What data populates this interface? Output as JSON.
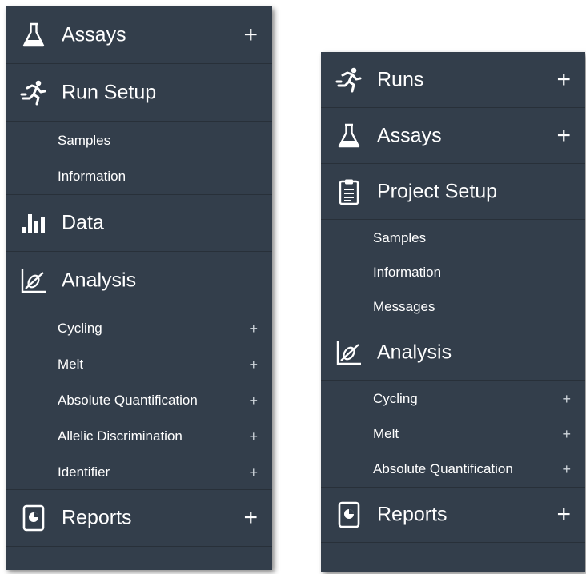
{
  "left_menu": {
    "assays": {
      "label": "Assays",
      "icon": "flask-icon",
      "expand": "+"
    },
    "run_setup": {
      "label": "Run Setup",
      "icon": "runner-icon"
    },
    "run_setup_items": [
      {
        "label": "Samples"
      },
      {
        "label": "Information"
      }
    ],
    "data": {
      "label": "Data",
      "icon": "bar-chart-icon"
    },
    "analysis": {
      "label": "Analysis",
      "icon": "analysis-chart-icon"
    },
    "analysis_items": [
      {
        "label": "Cycling",
        "expand": "+"
      },
      {
        "label": "Melt",
        "expand": "+"
      },
      {
        "label": "Absolute Quantification",
        "expand": "+"
      },
      {
        "label": "Allelic Discrimination",
        "expand": "+"
      },
      {
        "label": "Identifier",
        "expand": "+"
      }
    ],
    "reports": {
      "label": "Reports",
      "icon": "report-icon",
      "expand": "+"
    }
  },
  "right_menu": {
    "runs": {
      "label": "Runs",
      "icon": "runner-icon",
      "expand": "+"
    },
    "assays": {
      "label": "Assays",
      "icon": "flask-icon",
      "expand": "+"
    },
    "project_setup": {
      "label": "Project Setup",
      "icon": "clipboard-icon"
    },
    "project_setup_items": [
      {
        "label": "Samples"
      },
      {
        "label": "Information"
      },
      {
        "label": "Messages"
      }
    ],
    "analysis": {
      "label": "Analysis",
      "icon": "analysis-chart-icon"
    },
    "analysis_items": [
      {
        "label": "Cycling",
        "expand": "+"
      },
      {
        "label": "Melt",
        "expand": "+"
      },
      {
        "label": "Absolute Quantification",
        "expand": "+"
      }
    ],
    "reports": {
      "label": "Reports",
      "icon": "report-icon",
      "expand": "+"
    }
  },
  "colors": {
    "panel_bg": "#333e4b",
    "divider": "#283039",
    "text": "#ffffff"
  }
}
